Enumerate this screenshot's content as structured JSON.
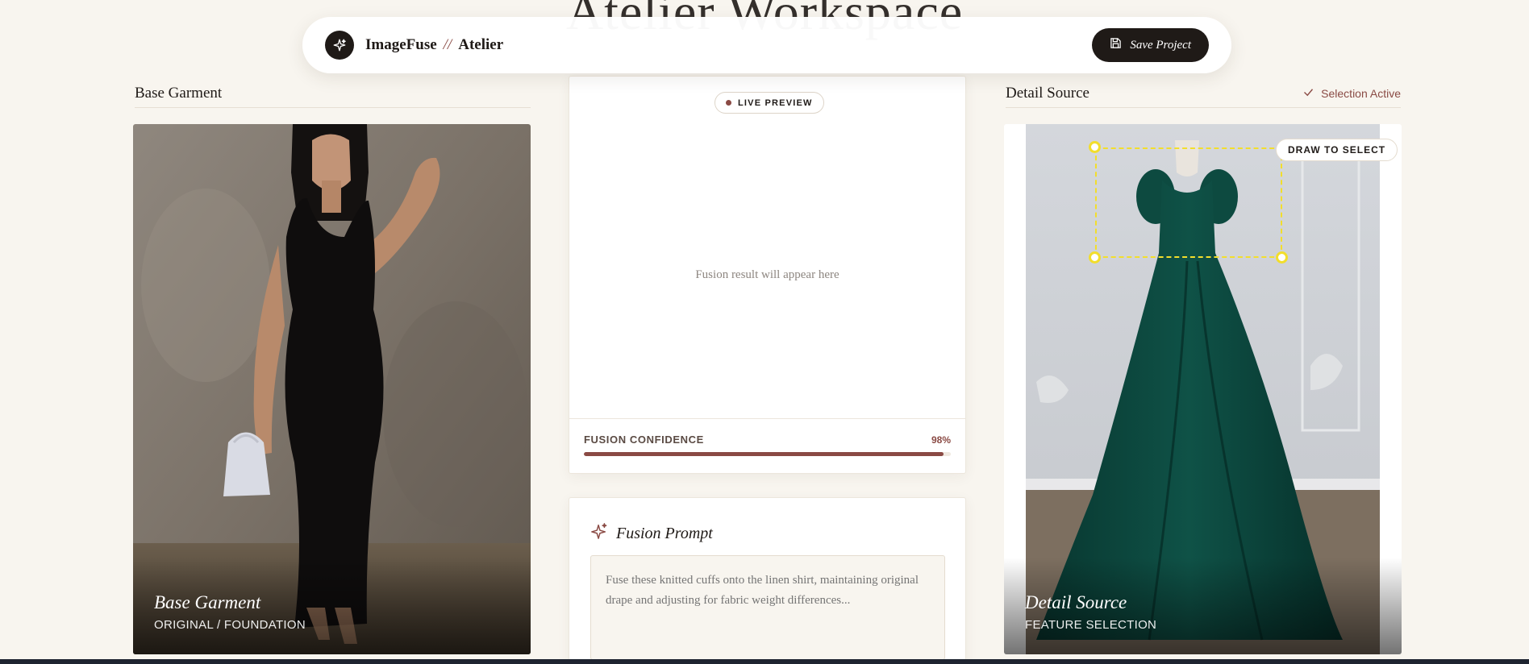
{
  "nav": {
    "brand_name": "ImageFuse",
    "brand_sep": "//",
    "brand_sub": "Atelier",
    "save_label": "Save Project",
    "logo_icon": "sparkle-icon",
    "save_icon": "save-icon"
  },
  "ghost_title": "Atelier Workspace",
  "left": {
    "header": "Base Garment",
    "caption_title": "Base Garment",
    "caption_sub": "ORIGINAL / FOUNDATION"
  },
  "center": {
    "live_label": "LIVE PREVIEW",
    "placeholder": "Fusion result will appear here",
    "confidence_label": "FUSION CONFIDENCE",
    "confidence_value": "98%",
    "confidence_fraction": 0.98,
    "prompt_title": "Fusion Prompt",
    "prompt_placeholder": "Fuse these knitted cuffs onto the linen shirt, maintaining original drape and adjusting for fabric weight differences..."
  },
  "right": {
    "header": "Detail Source",
    "status": "Selection Active",
    "draw_label": "DRAW TO SELECT",
    "caption_title": "Detail Source",
    "caption_sub": "FEATURE SELECTION"
  },
  "colors": {
    "accent": "#8a4a44",
    "dark": "#1f1a17",
    "selection": "#f2de2c",
    "background": "#f8f5ef"
  }
}
